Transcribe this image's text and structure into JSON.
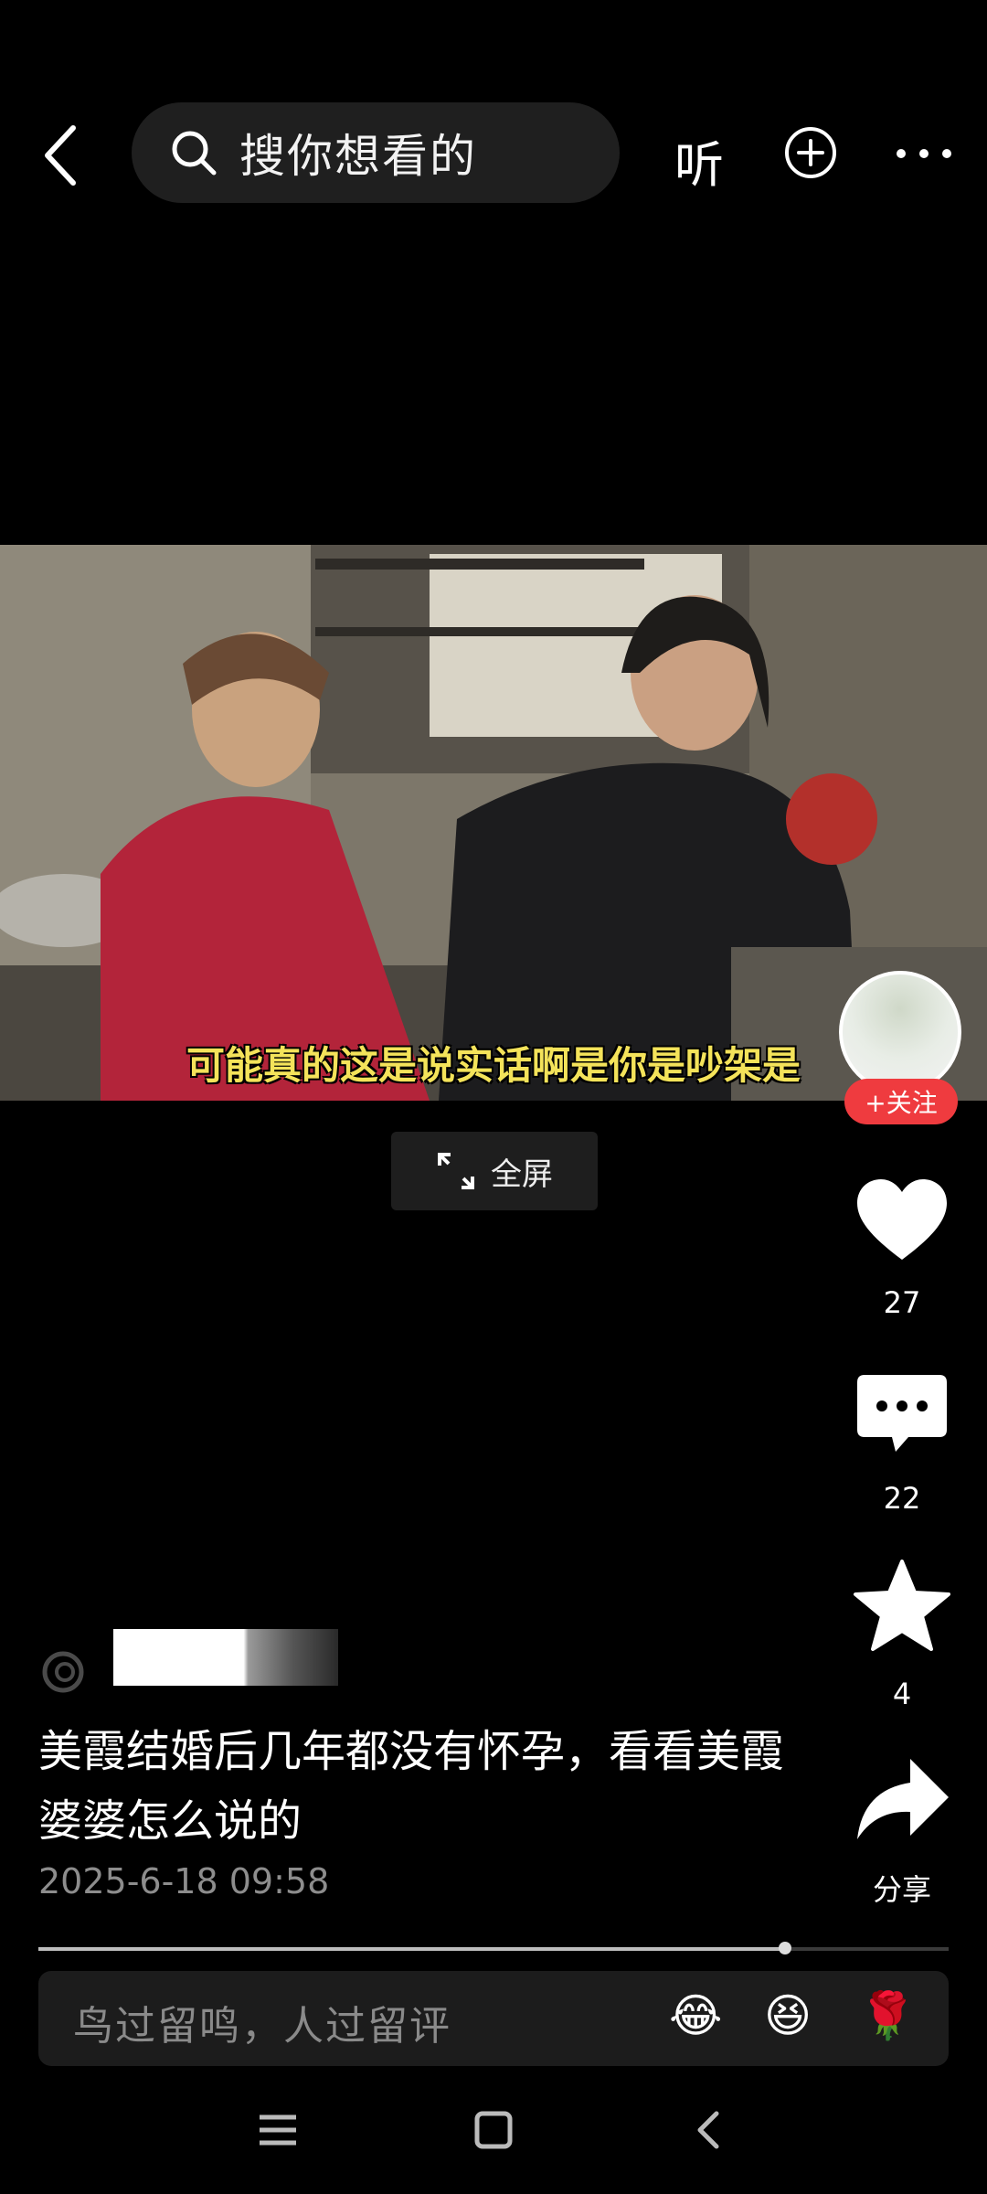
{
  "topbar": {
    "search_placeholder": "搜你想看的",
    "listen_label": "听"
  },
  "video": {
    "subtitle": "可能真的这是说实话啊是你是吵架是",
    "fullscreen_label": "全屏"
  },
  "rail": {
    "follow_label": "+关注",
    "like_count": "27",
    "comment_count": "22",
    "favorite_count": "4",
    "share_label": "分享"
  },
  "post": {
    "title": "美霞结婚后几年都没有怀孕，看看美霞婆婆怎么说的",
    "date": "2025-6-18 09:58"
  },
  "progress": {
    "fraction": 0.82
  },
  "comment": {
    "placeholder": "鸟过留鸣，人过留评",
    "emojis": [
      "😂",
      "😆",
      "🌹"
    ]
  },
  "colors": {
    "follow_red": "#ef3b3f",
    "subtitle_yellow": "#f4e35a"
  },
  "icons": [
    "back-icon",
    "search-icon",
    "add-icon",
    "more-icon",
    "expand-icon",
    "heart-icon",
    "comment-icon",
    "star-icon",
    "share-icon",
    "menu-icon",
    "home-icon",
    "nav-back-icon"
  ]
}
